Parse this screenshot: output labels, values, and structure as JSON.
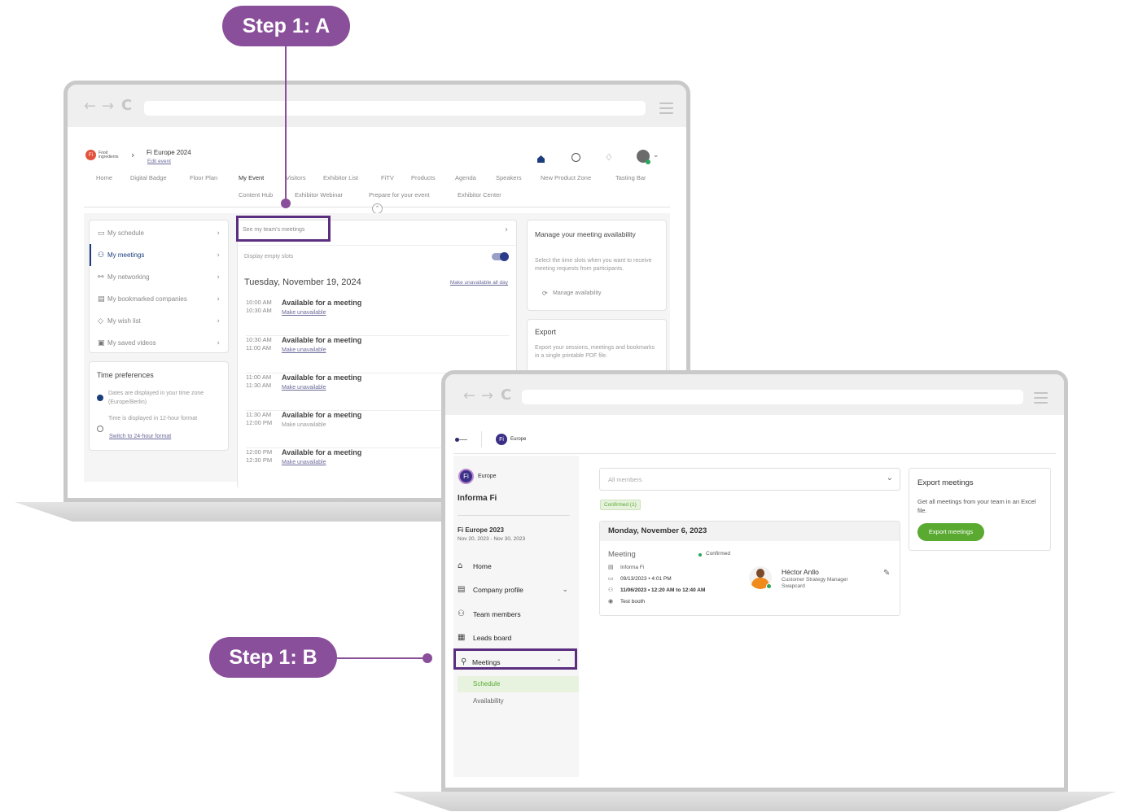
{
  "callouts": {
    "step_a": "Step 1: A",
    "step_b": "Step 1: B"
  },
  "colors": {
    "callout": "#8a4f9a",
    "highlight": "#5b2e80",
    "accent_green": "#5aaa32",
    "nav_blue": "#1a3d7c"
  },
  "back_app": {
    "brand_line1": "Food",
    "brand_line2": "ingredients",
    "event_name": "Fi Europe 2024",
    "edit_event": "Edit event",
    "nav_row1": [
      "Home",
      "Digital Badge",
      "Floor Plan",
      "My Event",
      "Visitors",
      "Exhibitor List",
      "FiTV",
      "Products",
      "Agenda",
      "Speakers",
      "New Product Zone",
      "Tasting Bar"
    ],
    "nav_row2": [
      "Content Hub",
      "Exhibitor Webinar",
      "Prepare for your event",
      "Exhibitor Center"
    ],
    "menu": [
      "My schedule",
      "My meetings",
      "My networking",
      "My bookmarked companies",
      "My wish list",
      "My saved videos"
    ],
    "time_prefs": {
      "title": "Time preferences",
      "tz_text": "Dates are displayed in your time zone (Europe/Berlin)",
      "fmt_text": "Time is displayed in 12-hour format",
      "switch_link": "Switch to 24-hour format"
    },
    "team_link": "See my team's meetings",
    "display_empty": "Display empty slots",
    "date": "Tuesday, November 19, 2024",
    "unavail_all": "Make unavailable all day",
    "slots": [
      {
        "start": "10:00 AM",
        "end": "10:30 AM",
        "status": "Available for a meeting",
        "action": "Make unavailable"
      },
      {
        "start": "10:30 AM",
        "end": "11:00 AM",
        "status": "Available for a meeting",
        "action": "Make unavailable"
      },
      {
        "start": "11:00 AM",
        "end": "11:30 AM",
        "status": "Available for a meeting",
        "action": "Make unavailable"
      },
      {
        "start": "11:30 AM",
        "end": "12:00 PM",
        "status": "Available for a meeting",
        "action": "Make unavailable"
      },
      {
        "start": "12:00 PM",
        "end": "12:30 PM",
        "status": "Available for a meeting",
        "action": "Make unavailable"
      }
    ],
    "availability_card": {
      "title": "Manage your meeting availability",
      "desc": "Select the time slots when you want to receive meeting requests from participants.",
      "action": "Manage availability"
    },
    "export_card": {
      "title": "Export",
      "desc": "Export your sessions, meetings and bookmarks in a single printable PDF file."
    }
  },
  "front_app": {
    "header_brand": "Europe",
    "side_brand": "Europe",
    "org_name": "Informa Fi",
    "event_name": "Fi Europe 2023",
    "event_dates": "Nov 20, 2023 - Nov 30, 2023",
    "sidebar": [
      "Home",
      "Company profile",
      "Team members",
      "Leads board",
      "Meetings"
    ],
    "submenu": [
      "Schedule",
      "Availability"
    ],
    "members_placeholder": "All members",
    "confirmed_badge": "Confirmed (1)",
    "date_header": "Monday, November 6, 2023",
    "meeting": {
      "title": "Meeting",
      "status": "Confirmed",
      "org": "Informa Fi",
      "created": "09/13/2023 • 4:01 PM",
      "when": "11/06/2023 • 12:20 AM to 12:40 AM",
      "where": "Test booth",
      "person_name": "Héctor Anllo",
      "person_role": "Customer Strategy Manager",
      "person_company": "Swapcard"
    },
    "export_card": {
      "title": "Export meetings",
      "desc": "Get all meetings from your team in an Excel file.",
      "button": "Export meetings"
    }
  }
}
